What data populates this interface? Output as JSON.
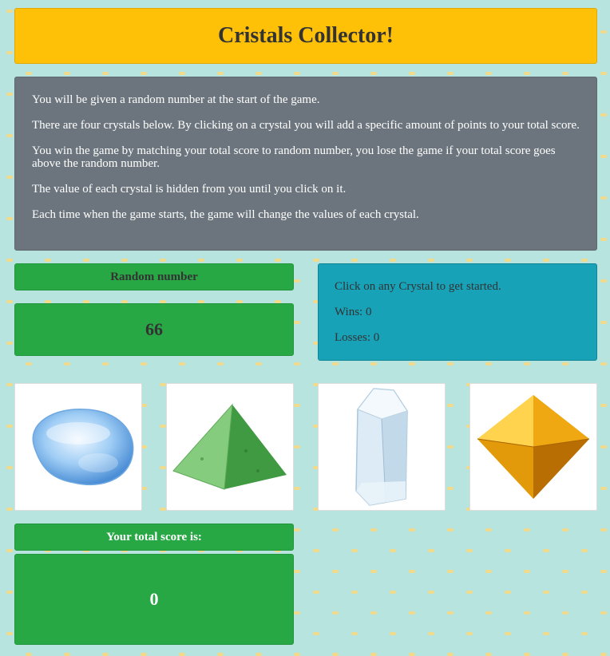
{
  "header": {
    "title": "Cristals Collector!"
  },
  "instructions": [
    "You will be given a random number at the start of the game.",
    "There are four crystals below. By clicking on a crystal you will add a specific amount of points to your total score.",
    "You win the game by matching your total score to random number, you lose the game if your total score goes above the random number.",
    "The value of each crystal is hidden from you until you click on it.",
    "Each time when the game starts, the game will change the values of each crystal."
  ],
  "random": {
    "label": "Random number",
    "value": "66"
  },
  "status": {
    "message": "Click on any Crystal to get started.",
    "wins": "Wins: 0",
    "losses": "Losses: 0"
  },
  "crystals": [
    {
      "icon": "blue-crystal-icon",
      "color": "#8fc3f0"
    },
    {
      "icon": "green-pyramid-crystal-icon",
      "color": "#5fb35c"
    },
    {
      "icon": "clear-quartz-crystal-icon",
      "color": "#d9ecf7"
    },
    {
      "icon": "yellow-octahedron-crystal-icon",
      "color": "#f0a500"
    }
  ],
  "score": {
    "label": "Your total score is:",
    "value": "0"
  },
  "colors": {
    "title_bg": "#ffc107",
    "info_bg": "#6c757d",
    "panel_green": "#28a745",
    "panel_teal": "#17a2b8",
    "page_bg": "#b7e4df"
  }
}
